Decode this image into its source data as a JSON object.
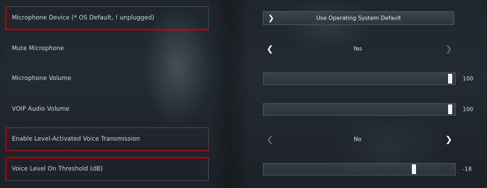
{
  "settings": [
    {
      "label": "Microphone Device (* OS Default, ! unplugged)",
      "control": "dropdown",
      "value": "Use Operating System Default",
      "highlighted": true
    },
    {
      "label": "Mute Microphone",
      "control": "selector",
      "value": "Yes",
      "left_enabled": true,
      "right_enabled": false,
      "highlighted": false
    },
    {
      "label": "Microphone Volume",
      "control": "slider",
      "value": "100",
      "level": 1.0,
      "highlighted": false
    },
    {
      "label": "VOIP Audio Volume",
      "control": "slider",
      "value": "100",
      "level": 1.0,
      "highlighted": false
    },
    {
      "label": "Enable Level-Activated Voice Transmission",
      "control": "selector",
      "value": "No",
      "left_enabled": false,
      "right_enabled": true,
      "highlighted": true
    },
    {
      "label": "Voice Level On Threshold (dB)",
      "control": "slider",
      "value": "-18",
      "level": 0.8,
      "highlighted": true
    }
  ],
  "colors": {
    "highlight": "#c0151f",
    "text": "#d4d9dd",
    "knob": "#f2f4f5"
  },
  "icons": {
    "dropdown": "chevron-right-icon",
    "prev": "chevron-left-icon",
    "next": "chevron-right-icon"
  }
}
